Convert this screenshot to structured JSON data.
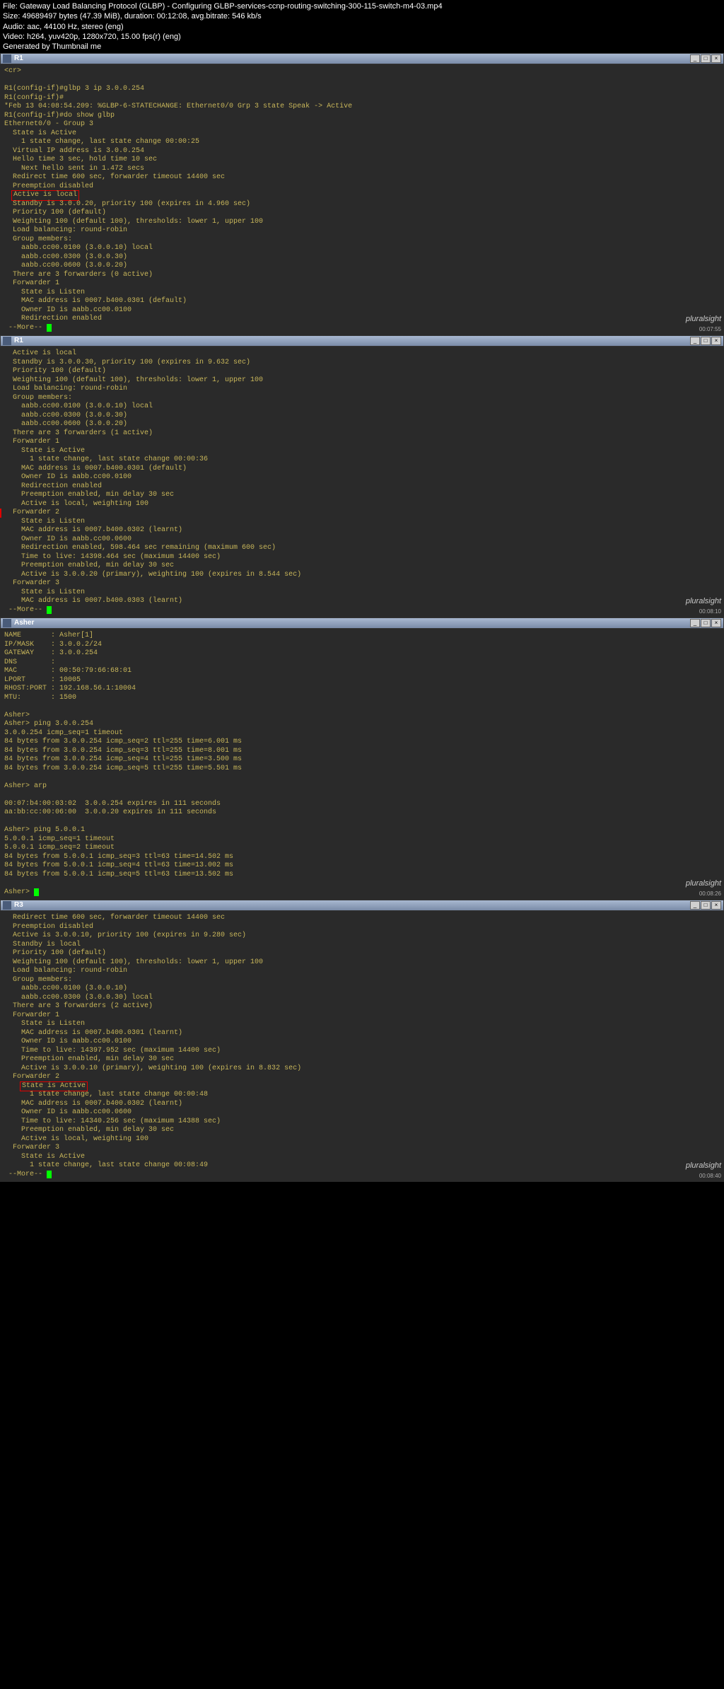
{
  "header": {
    "file": "File: Gateway Load Balancing Protocol (GLBP) - Configuring GLBP-services-ccnp-routing-switching-300-115-switch-m4-03.mp4",
    "size": "Size: 49689497 bytes (47.39 MiB), duration: 00:12:08, avg.bitrate: 546 kb/s",
    "audio": "Audio: aac, 44100 Hz, stereo (eng)",
    "video": "Video: h264, yuv420p, 1280x720, 15.00 fps(r) (eng)",
    "gen": "Generated by Thumbnail me"
  },
  "panels": [
    {
      "title": "R1",
      "timecode": "00:07:55",
      "lines": [
        {
          "t": "<cr>",
          "i": 0
        },
        {
          "t": "",
          "i": 0
        },
        {
          "t": "R1(config-if)#glbp 3 ip 3.0.0.254",
          "i": 0
        },
        {
          "t": "R1(config-if)#",
          "i": 0
        },
        {
          "t": "*Feb 13 04:08:54.209: %GLBP-6-STATECHANGE: Ethernet0/0 Grp 3 state Speak -> Active",
          "i": 0
        },
        {
          "t": "R1(config-if)#do show glbp",
          "i": 0
        },
        {
          "t": "Ethernet0/0 - Group 3",
          "i": 0
        },
        {
          "t": "State is Active",
          "i": 1
        },
        {
          "t": "1 state change, last state change 00:00:25",
          "i": 2
        },
        {
          "t": "Virtual IP address is 3.0.0.254",
          "i": 1
        },
        {
          "t": "Hello time 3 sec, hold time 10 sec",
          "i": 1
        },
        {
          "t": "Next hello sent in 1.472 secs",
          "i": 2
        },
        {
          "t": "Redirect time 600 sec, forwarder timeout 14400 sec",
          "i": 1
        },
        {
          "t": "Preemption disabled",
          "i": 1
        },
        {
          "t": "Active is local",
          "i": 1,
          "redbox": true
        },
        {
          "t": "Standby is 3.0.0.20, priority 100 (expires in 4.960 sec)",
          "i": 1
        },
        {
          "t": "Priority 100 (default)",
          "i": 1
        },
        {
          "t": "Weighting 100 (default 100), thresholds: lower 1, upper 100",
          "i": 1
        },
        {
          "t": "Load balancing: round-robin",
          "i": 1
        },
        {
          "t": "Group members:",
          "i": 1
        },
        {
          "t": "aabb.cc00.0100 (3.0.0.10) local",
          "i": 2
        },
        {
          "t": "aabb.cc00.0300 (3.0.0.30)",
          "i": 2
        },
        {
          "t": "aabb.cc00.0600 (3.0.0.20)",
          "i": 2
        },
        {
          "t": "There are 3 forwarders (0 active)",
          "i": 1
        },
        {
          "t": "Forwarder 1",
          "i": 1
        },
        {
          "t": "State is Listen",
          "i": 2
        },
        {
          "t": "MAC address is 0007.b400.0301 (default)",
          "i": 2
        },
        {
          "t": "Owner ID is aabb.cc00.0100",
          "i": 2
        },
        {
          "t": "Redirection enabled",
          "i": 2
        },
        {
          "t": " --More-- ",
          "i": 0,
          "cursor": true
        }
      ]
    },
    {
      "title": "R1",
      "timecode": "00:08:10",
      "lines": [
        {
          "t": "Active is local",
          "i": 1
        },
        {
          "t": "Standby is 3.0.0.30, priority 100 (expires in 9.632 sec)",
          "i": 1
        },
        {
          "t": "Priority 100 (default)",
          "i": 1
        },
        {
          "t": "Weighting 100 (default 100), thresholds: lower 1, upper 100",
          "i": 1
        },
        {
          "t": "Load balancing: round-robin",
          "i": 1
        },
        {
          "t": "Group members:",
          "i": 1
        },
        {
          "t": "aabb.cc00.0100 (3.0.0.10) local",
          "i": 2
        },
        {
          "t": "aabb.cc00.0300 (3.0.0.30)",
          "i": 2
        },
        {
          "t": "aabb.cc00.0600 (3.0.0.20)",
          "i": 2
        },
        {
          "t": "There are 3 forwarders (1 active)",
          "i": 1
        },
        {
          "t": "Forwarder 1",
          "i": 1
        },
        {
          "t": "State is Active",
          "i": 2
        },
        {
          "t": "1 state change, last state change 00:00:36",
          "i": 3
        },
        {
          "t": "MAC address is 0007.b400.0301 (default)",
          "i": 2
        },
        {
          "t": "Owner ID is aabb.cc00.0100",
          "i": 2
        },
        {
          "t": "Redirection enabled",
          "i": 2
        },
        {
          "t": "Preemption enabled, min delay 30 sec",
          "i": 2
        },
        {
          "t": "Active is local, weighting 100",
          "i": 2
        },
        {
          "t": "Forwarder 2",
          "i": 1,
          "redmark": true
        },
        {
          "t": "State is Listen",
          "i": 2
        },
        {
          "t": "MAC address is 0007.b400.0302 (learnt)",
          "i": 2
        },
        {
          "t": "Owner ID is aabb.cc00.0600",
          "i": 2
        },
        {
          "t": "Redirection enabled, 598.464 sec remaining (maximum 600 sec)",
          "i": 2
        },
        {
          "t": "Time to live: 14398.464 sec (maximum 14400 sec)",
          "i": 2
        },
        {
          "t": "Preemption enabled, min delay 30 sec",
          "i": 2
        },
        {
          "t": "Active is 3.0.0.20 (primary), weighting 100 (expires in 8.544 sec)",
          "i": 2
        },
        {
          "t": "Forwarder 3",
          "i": 1
        },
        {
          "t": "State is Listen",
          "i": 2
        },
        {
          "t": "MAC address is 0007.b400.0303 (learnt)",
          "i": 2
        },
        {
          "t": " --More-- ",
          "i": 0,
          "cursor": true
        }
      ]
    },
    {
      "title": "Asher",
      "timecode": "00:08:26",
      "lines": [
        {
          "t": "NAME       : Asher[1]",
          "i": 0
        },
        {
          "t": "IP/MASK    : 3.0.0.2/24",
          "i": 0
        },
        {
          "t": "GATEWAY    : 3.0.0.254",
          "i": 0
        },
        {
          "t": "DNS        :",
          "i": 0
        },
        {
          "t": "MAC        : 00:50:79:66:68:01",
          "i": 0
        },
        {
          "t": "LPORT      : 10005",
          "i": 0
        },
        {
          "t": "RHOST:PORT : 192.168.56.1:10004",
          "i": 0
        },
        {
          "t": "MTU:       : 1500",
          "i": 0
        },
        {
          "t": "",
          "i": 0
        },
        {
          "t": "Asher>",
          "i": 0
        },
        {
          "t": "Asher> ping 3.0.0.254",
          "i": 0
        },
        {
          "t": "3.0.0.254 icmp_seq=1 timeout",
          "i": 0
        },
        {
          "t": "84 bytes from 3.0.0.254 icmp_seq=2 ttl=255 time=6.001 ms",
          "i": 0
        },
        {
          "t": "84 bytes from 3.0.0.254 icmp_seq=3 ttl=255 time=8.001 ms",
          "i": 0
        },
        {
          "t": "84 bytes from 3.0.0.254 icmp_seq=4 ttl=255 time=3.500 ms",
          "i": 0
        },
        {
          "t": "84 bytes from 3.0.0.254 icmp_seq=5 ttl=255 time=5.501 ms",
          "i": 0
        },
        {
          "t": "",
          "i": 0
        },
        {
          "t": "Asher> arp",
          "i": 0
        },
        {
          "t": "",
          "i": 0
        },
        {
          "t": "00:07:b4:00:03:02  3.0.0.254 expires in 111 seconds",
          "i": 0
        },
        {
          "t": "aa:bb:cc:00:06:00  3.0.0.20 expires in 111 seconds",
          "i": 0
        },
        {
          "t": "",
          "i": 0
        },
        {
          "t": "Asher> ping 5.0.0.1",
          "i": 0
        },
        {
          "t": "5.0.0.1 icmp_seq=1 timeout",
          "i": 0
        },
        {
          "t": "5.0.0.1 icmp_seq=2 timeout",
          "i": 0
        },
        {
          "t": "84 bytes from 5.0.0.1 icmp_seq=3 ttl=63 time=14.502 ms",
          "i": 0
        },
        {
          "t": "84 bytes from 5.0.0.1 icmp_seq=4 ttl=63 time=13.002 ms",
          "i": 0
        },
        {
          "t": "84 bytes from 5.0.0.1 icmp_seq=5 ttl=63 time=13.502 ms",
          "i": 0
        },
        {
          "t": "",
          "i": 0
        },
        {
          "t": "Asher> ",
          "i": 0,
          "cursor": true
        }
      ]
    },
    {
      "title": "R3",
      "timecode": "00:08:40",
      "lines": [
        {
          "t": "Redirect time 600 sec, forwarder timeout 14400 sec",
          "i": 1
        },
        {
          "t": "Preemption disabled",
          "i": 1
        },
        {
          "t": "Active is 3.0.0.10, priority 100 (expires in 9.280 sec)",
          "i": 1
        },
        {
          "t": "Standby is local",
          "i": 1
        },
        {
          "t": "Priority 100 (default)",
          "i": 1
        },
        {
          "t": "Weighting 100 (default 100), thresholds: lower 1, upper 100",
          "i": 1
        },
        {
          "t": "Load balancing: round-robin",
          "i": 1
        },
        {
          "t": "Group members:",
          "i": 1
        },
        {
          "t": "aabb.cc00.0100 (3.0.0.10)",
          "i": 2
        },
        {
          "t": "aabb.cc00.0300 (3.0.0.30) local",
          "i": 2
        },
        {
          "t": "There are 3 forwarders (2 active)",
          "i": 1
        },
        {
          "t": "Forwarder 1",
          "i": 1
        },
        {
          "t": "State is Listen",
          "i": 2
        },
        {
          "t": "MAC address is 0007.b400.0301 (learnt)",
          "i": 2
        },
        {
          "t": "Owner ID is aabb.cc00.0100",
          "i": 2
        },
        {
          "t": "Time to live: 14397.952 sec (maximum 14400 sec)",
          "i": 2
        },
        {
          "t": "Preemption enabled, min delay 30 sec",
          "i": 2
        },
        {
          "t": "Active is 3.0.0.10 (primary), weighting 100 (expires in 8.832 sec)",
          "i": 2
        },
        {
          "t": "Forwarder 2",
          "i": 1
        },
        {
          "t": "State is Active",
          "i": 2,
          "redbox": true
        },
        {
          "t": "1 state change, last state change 00:00:48",
          "i": 3
        },
        {
          "t": "MAC address is 0007.b400.0302 (learnt)",
          "i": 2
        },
        {
          "t": "Owner ID is aabb.cc00.0600",
          "i": 2
        },
        {
          "t": "Time to live: 14340.256 sec (maximum 14388 sec)",
          "i": 2
        },
        {
          "t": "Preemption enabled, min delay 30 sec",
          "i": 2
        },
        {
          "t": "Active is local, weighting 100",
          "i": 2
        },
        {
          "t": "Forwarder 3",
          "i": 1
        },
        {
          "t": "State is Active",
          "i": 2
        },
        {
          "t": "1 state change, last state change 00:08:49",
          "i": 3
        },
        {
          "t": " --More-- ",
          "i": 0,
          "cursor": true
        }
      ]
    }
  ],
  "watermark": "pluralsight"
}
